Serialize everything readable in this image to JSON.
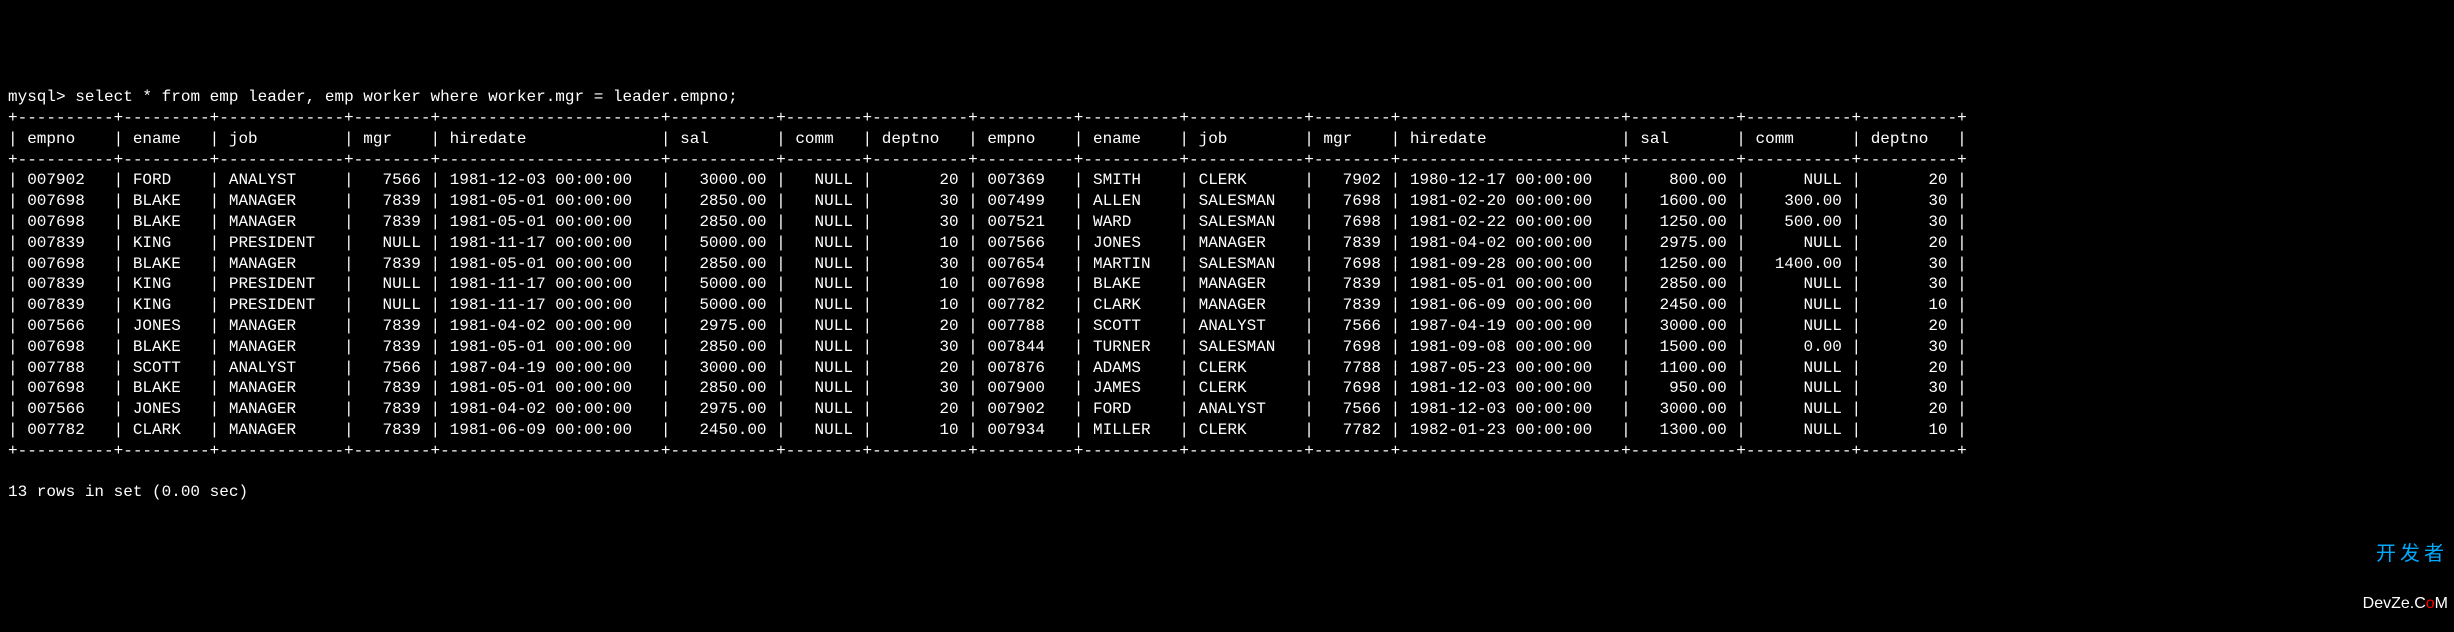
{
  "prompt": "mysql> ",
  "query": "select * from emp leader, emp worker where worker.mgr = leader.empno;",
  "footer": "13 rows in set (0.00 sec)",
  "watermark": {
    "line1": "开发者",
    "line2_pre": "DevZe.C",
    "line2_o": "o",
    "line2_post": "M"
  },
  "columns": [
    {
      "name": "empno",
      "width": 8,
      "align": "left"
    },
    {
      "name": "ename",
      "width": 7,
      "align": "left"
    },
    {
      "name": "job",
      "width": 11,
      "align": "left"
    },
    {
      "name": "mgr",
      "width": 6,
      "align": "right"
    },
    {
      "name": "hiredate",
      "width": 21,
      "align": "left"
    },
    {
      "name": "sal",
      "width": 9,
      "align": "right"
    },
    {
      "name": "comm",
      "width": 6,
      "align": "right"
    },
    {
      "name": "deptno",
      "width": 8,
      "align": "right"
    },
    {
      "name": "empno",
      "width": 8,
      "align": "left"
    },
    {
      "name": "ename",
      "width": 8,
      "align": "left"
    },
    {
      "name": "job",
      "width": 10,
      "align": "left"
    },
    {
      "name": "mgr",
      "width": 6,
      "align": "right"
    },
    {
      "name": "hiredate",
      "width": 21,
      "align": "left"
    },
    {
      "name": "sal",
      "width": 9,
      "align": "right"
    },
    {
      "name": "comm",
      "width": 9,
      "align": "right"
    },
    {
      "name": "deptno",
      "width": 8,
      "align": "right"
    }
  ],
  "rows": [
    [
      "007902",
      "FORD",
      "ANALYST",
      "7566",
      "1981-12-03 00:00:00",
      "3000.00",
      "NULL",
      "20",
      "007369",
      "SMITH",
      "CLERK",
      "7902",
      "1980-12-17 00:00:00",
      "800.00",
      "NULL",
      "20"
    ],
    [
      "007698",
      "BLAKE",
      "MANAGER",
      "7839",
      "1981-05-01 00:00:00",
      "2850.00",
      "NULL",
      "30",
      "007499",
      "ALLEN",
      "SALESMAN",
      "7698",
      "1981-02-20 00:00:00",
      "1600.00",
      "300.00",
      "30"
    ],
    [
      "007698",
      "BLAKE",
      "MANAGER",
      "7839",
      "1981-05-01 00:00:00",
      "2850.00",
      "NULL",
      "30",
      "007521",
      "WARD",
      "SALESMAN",
      "7698",
      "1981-02-22 00:00:00",
      "1250.00",
      "500.00",
      "30"
    ],
    [
      "007839",
      "KING",
      "PRESIDENT",
      "NULL",
      "1981-11-17 00:00:00",
      "5000.00",
      "NULL",
      "10",
      "007566",
      "JONES",
      "MANAGER",
      "7839",
      "1981-04-02 00:00:00",
      "2975.00",
      "NULL",
      "20"
    ],
    [
      "007698",
      "BLAKE",
      "MANAGER",
      "7839",
      "1981-05-01 00:00:00",
      "2850.00",
      "NULL",
      "30",
      "007654",
      "MARTIN",
      "SALESMAN",
      "7698",
      "1981-09-28 00:00:00",
      "1250.00",
      "1400.00",
      "30"
    ],
    [
      "007839",
      "KING",
      "PRESIDENT",
      "NULL",
      "1981-11-17 00:00:00",
      "5000.00",
      "NULL",
      "10",
      "007698",
      "BLAKE",
      "MANAGER",
      "7839",
      "1981-05-01 00:00:00",
      "2850.00",
      "NULL",
      "30"
    ],
    [
      "007839",
      "KING",
      "PRESIDENT",
      "NULL",
      "1981-11-17 00:00:00",
      "5000.00",
      "NULL",
      "10",
      "007782",
      "CLARK",
      "MANAGER",
      "7839",
      "1981-06-09 00:00:00",
      "2450.00",
      "NULL",
      "10"
    ],
    [
      "007566",
      "JONES",
      "MANAGER",
      "7839",
      "1981-04-02 00:00:00",
      "2975.00",
      "NULL",
      "20",
      "007788",
      "SCOTT",
      "ANALYST",
      "7566",
      "1987-04-19 00:00:00",
      "3000.00",
      "NULL",
      "20"
    ],
    [
      "007698",
      "BLAKE",
      "MANAGER",
      "7839",
      "1981-05-01 00:00:00",
      "2850.00",
      "NULL",
      "30",
      "007844",
      "TURNER",
      "SALESMAN",
      "7698",
      "1981-09-08 00:00:00",
      "1500.00",
      "0.00",
      "30"
    ],
    [
      "007788",
      "SCOTT",
      "ANALYST",
      "7566",
      "1987-04-19 00:00:00",
      "3000.00",
      "NULL",
      "20",
      "007876",
      "ADAMS",
      "CLERK",
      "7788",
      "1987-05-23 00:00:00",
      "1100.00",
      "NULL",
      "20"
    ],
    [
      "007698",
      "BLAKE",
      "MANAGER",
      "7839",
      "1981-05-01 00:00:00",
      "2850.00",
      "NULL",
      "30",
      "007900",
      "JAMES",
      "CLERK",
      "7698",
      "1981-12-03 00:00:00",
      "950.00",
      "NULL",
      "30"
    ],
    [
      "007566",
      "JONES",
      "MANAGER",
      "7839",
      "1981-04-02 00:00:00",
      "2975.00",
      "NULL",
      "20",
      "007902",
      "FORD",
      "ANALYST",
      "7566",
      "1981-12-03 00:00:00",
      "3000.00",
      "NULL",
      "20"
    ],
    [
      "007782",
      "CLARK",
      "MANAGER",
      "7839",
      "1981-06-09 00:00:00",
      "2450.00",
      "NULL",
      "10",
      "007934",
      "MILLER",
      "CLERK",
      "7782",
      "1982-01-23 00:00:00",
      "1300.00",
      "NULL",
      "10"
    ]
  ]
}
